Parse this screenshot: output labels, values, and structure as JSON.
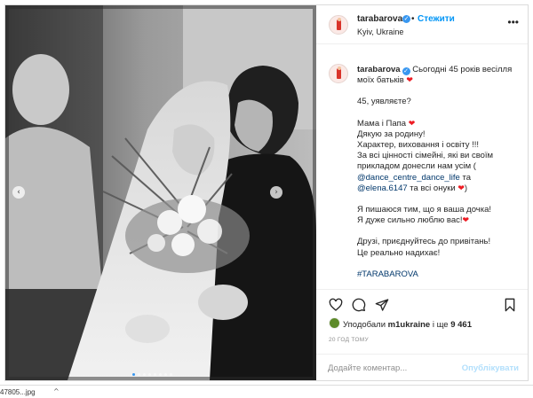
{
  "post": {
    "username": "tarabarova",
    "follow_label": "Стежити",
    "separator": "•",
    "location": "Kyiv, Ukraine",
    "more_icon": "more-horizontal-icon"
  },
  "caption": {
    "username": "tarabarova",
    "first_line": "Сьогодні 45 років весілля моїх батьків",
    "p2": "45, уявляєте?",
    "p3_l1": "Мама і Папа",
    "p3_l2": "Дякую за родину!",
    "p3_l3": "Характер, виховання і освіту !!!",
    "p3_l4": "За всі цінності сімейні, які ви своїм прикладом донесли нам усім (",
    "p3_m1": "@dance_centre_dance_life",
    "p3_m1_after": " та",
    "p3_m2": "@elena.6147",
    "p3_m2_after": " та всі онуки",
    "p3_close": ")",
    "p4_l1": "Я пишаюся тим, що я ваша дочка!",
    "p4_l2": "Я дуже сильно люблю вас!",
    "p5_l1": "Друзі, приєднуйтесь до привітань!",
    "p5_l2": "Це реально надихає!",
    "hashtag": "#TARABAROVA"
  },
  "likes": {
    "prefix": "Уподобали",
    "user": "m1ukraine",
    "mid": " і ще ",
    "count": "9 461"
  },
  "timestamp": "20 ГОД ТОМУ",
  "comment": {
    "placeholder": "Додайте коментар...",
    "publish_label": "Опублікувати"
  },
  "carousel": {
    "dots_total": 8,
    "active_index": 0
  },
  "download": {
    "file_name": "47805...jpg",
    "caret": "^"
  },
  "colors": {
    "accent": "#0095f6",
    "heart": "#ed1c24",
    "publish_disabled": "#b2dffc"
  }
}
